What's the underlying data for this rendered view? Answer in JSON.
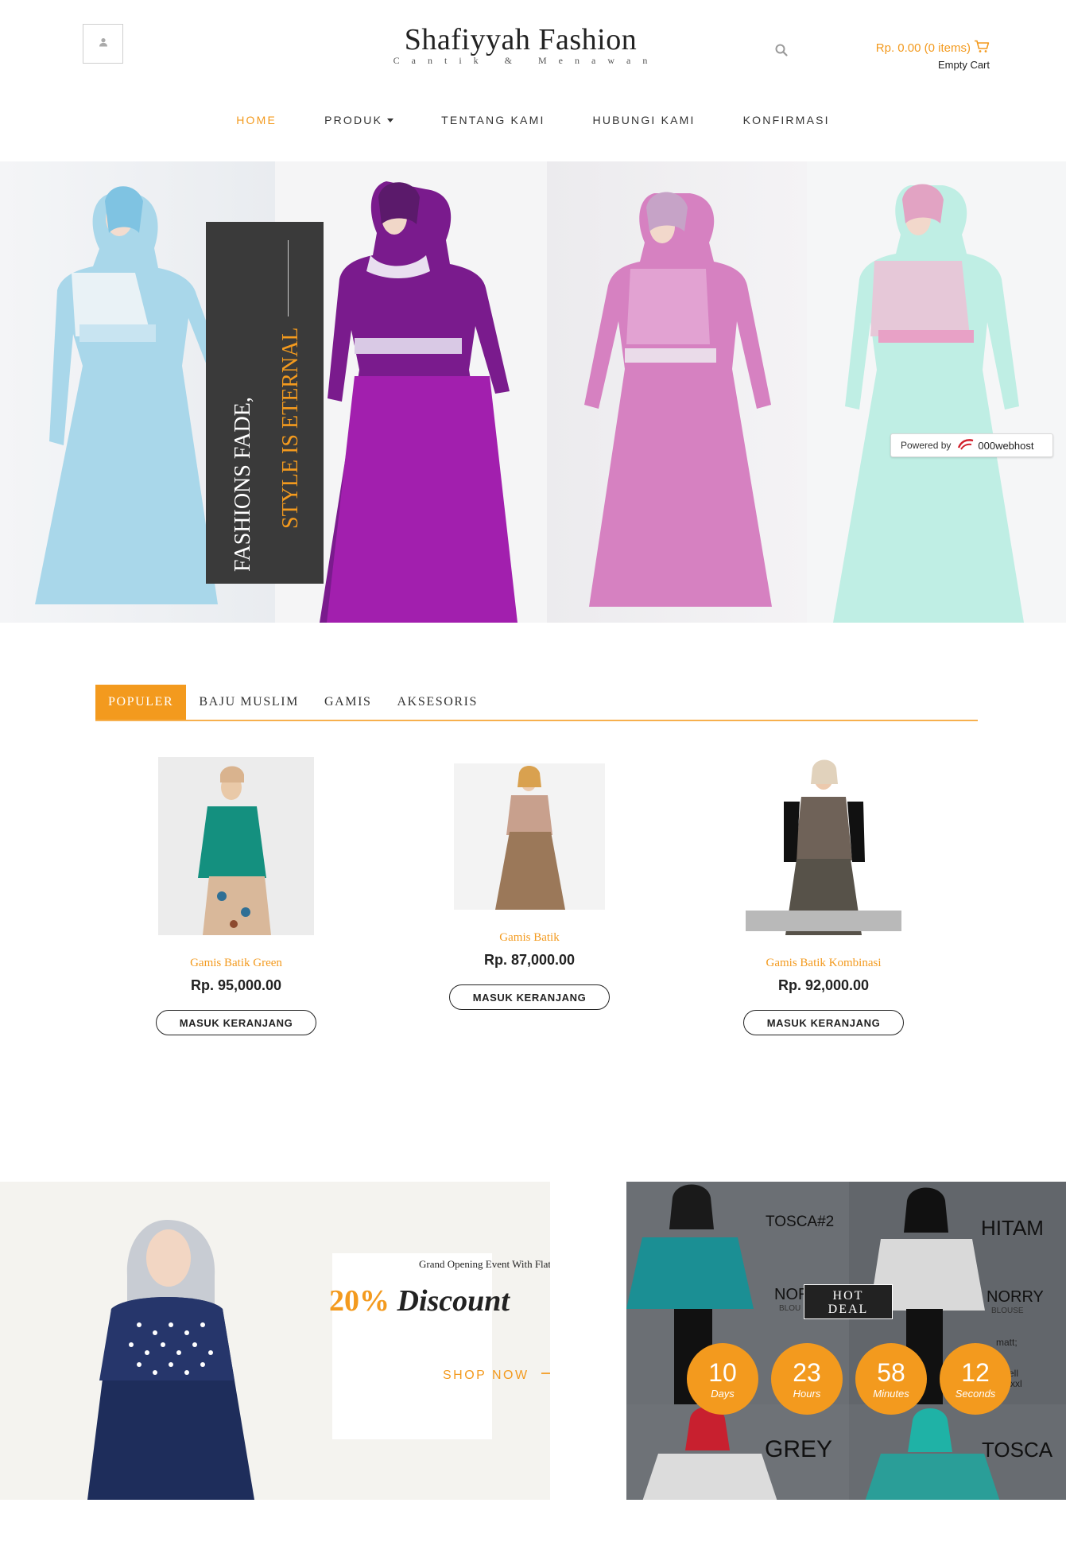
{
  "header": {
    "brand_title": "Shafiyyah Fashion",
    "brand_tagline": "Cantik & Menawan",
    "cart_total": "Rp. 0.00 (0 items)",
    "cart_status": "Empty Cart"
  },
  "nav": {
    "items": [
      {
        "label": "HOME",
        "active": true
      },
      {
        "label": "PRODUK",
        "dropdown": true
      },
      {
        "label": "TENTANG KAMI"
      },
      {
        "label": "HUBUNGI KAMI"
      },
      {
        "label": "KONFIRMASI"
      }
    ]
  },
  "hero": {
    "quote_line1": "FASHIONS FADE,",
    "quote_line2": "STYLE IS ETERNAL",
    "powered_label": "Powered by",
    "powered_brand": "000webhost"
  },
  "tabs": [
    {
      "label": "POPULER",
      "active": true
    },
    {
      "label": "BAJU MUSLIM"
    },
    {
      "label": "GAMIS"
    },
    {
      "label": "AKSESORIS"
    }
  ],
  "products": [
    {
      "name": "Gamis Batik Green",
      "price": "Rp. 95,000.00",
      "button": "MASUK KERANJANG"
    },
    {
      "name": "Gamis Batik",
      "price": "Rp. 87,000.00",
      "button": "MASUK KERANJANG"
    },
    {
      "name": "Gamis Batik Kombinasi",
      "price": "Rp. 92,000.00",
      "button": "MASUK KERANJANG"
    }
  ],
  "promo": {
    "subtitle": "Grand Opening Event With Flat",
    "percent": "20%",
    "discount_word": "Discount",
    "cta": "SHOP NOW"
  },
  "deal": {
    "badge_line1": "HOT",
    "badge_line2": "DEAL",
    "labels": {
      "top_left": "TOSCA#2",
      "top_right": "HITAM",
      "brand_right": "NORRY",
      "brand_right_sub": "BLOUSE",
      "brand_left": "NOR",
      "brand_left_sub": "BLOU",
      "note1": "matt;",
      "note2": "ell",
      "note3": "xxl",
      "bottom_left": "GREY",
      "bottom_right": "TOSCA"
    },
    "countdown": [
      {
        "value": "10",
        "unit": "Days"
      },
      {
        "value": "23",
        "unit": "Hours"
      },
      {
        "value": "58",
        "unit": "Minutes"
      },
      {
        "value": "12",
        "unit": "Seconds"
      }
    ]
  },
  "colors": {
    "accent": "#f39a1e",
    "dark_box": "#3a3a3a",
    "text": "#333333"
  },
  "icons": [
    "user-icon",
    "search-icon",
    "cart-icon",
    "caret-down-icon",
    "arrow-right-icon",
    "webhost-logo-icon"
  ]
}
